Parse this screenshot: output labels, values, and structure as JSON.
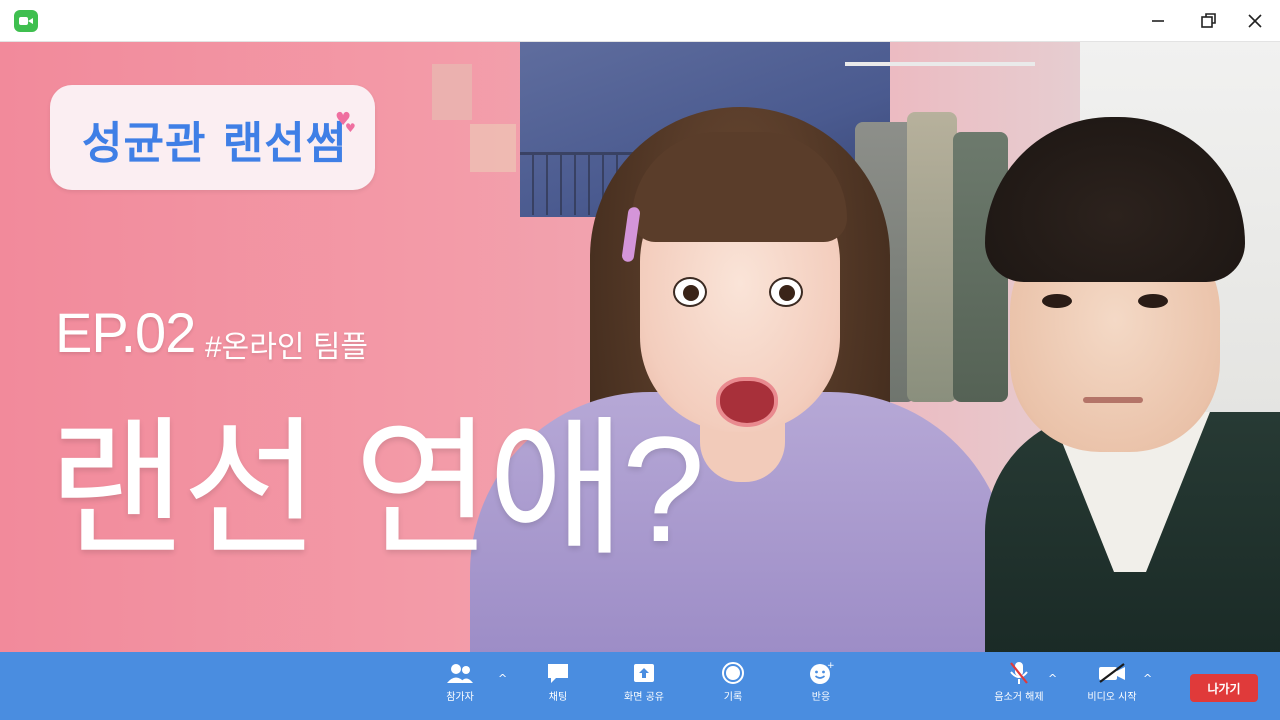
{
  "window": {
    "minimize_icon": "minimize-icon",
    "maximize_icon": "restore-icon",
    "close_icon": "close-icon"
  },
  "overlay": {
    "series_title": "성균관 랜선썸",
    "episode": "EP.02",
    "hashtag": "#온라인 팀플",
    "headline": "랜선 연애?"
  },
  "toolbar": {
    "participants_label": "참가자",
    "chat_label": "채팅",
    "share_label": "화면 공유",
    "record_label": "기록",
    "reactions_label": "반응",
    "mute_label": "음소거 해제",
    "video_label": "비디오 시작",
    "leave_label": "나가기"
  },
  "colors": {
    "toolbar": "#4a8de0",
    "leave": "#e03a3a",
    "title": "#3f7fe6",
    "app_icon": "#3fbf4f"
  }
}
